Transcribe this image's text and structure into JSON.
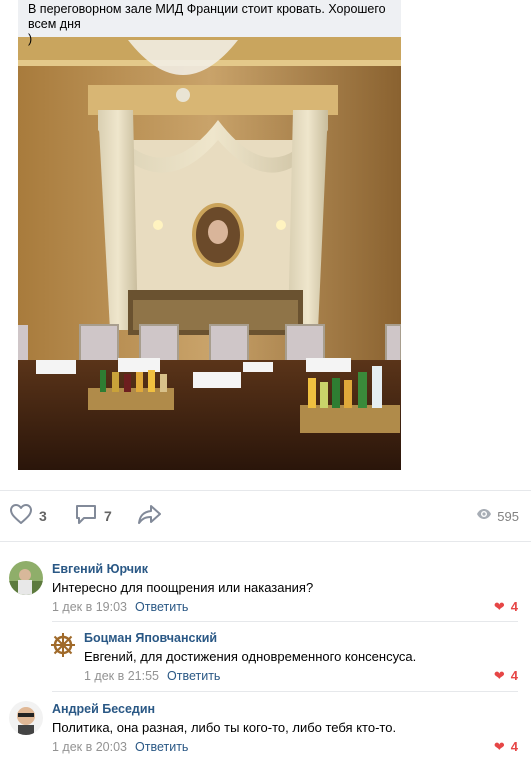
{
  "post": {
    "text": "В переговорном зале МИД Франции стоит кровать. Хорошего всем дня\n)",
    "photo_alt": "photo"
  },
  "actions": {
    "likes": "3",
    "comments": "7",
    "views": "595"
  },
  "colors": {
    "link": "#2a5885",
    "like": "#e64646",
    "meta": "#939393"
  },
  "comments": [
    {
      "author": "Евгений Юрчик",
      "text": "Интересно для поощрения или наказания?",
      "date": "1 дек в 19:03",
      "reply_label": "Ответить",
      "likes": "4"
    },
    {
      "author": "Боцман Яповчанский",
      "text": "Евгений, для достижения одновременного консенсуса.",
      "date": "1 дек в 21:55",
      "reply_label": "Ответить",
      "likes": "4"
    },
    {
      "author": "Андрей Беседин",
      "text": "Политика, она разная, либо ты кого-то, либо тебя кто-то.",
      "date": "1 дек в 20:03",
      "reply_label": "Ответить",
      "likes": "4"
    }
  ]
}
